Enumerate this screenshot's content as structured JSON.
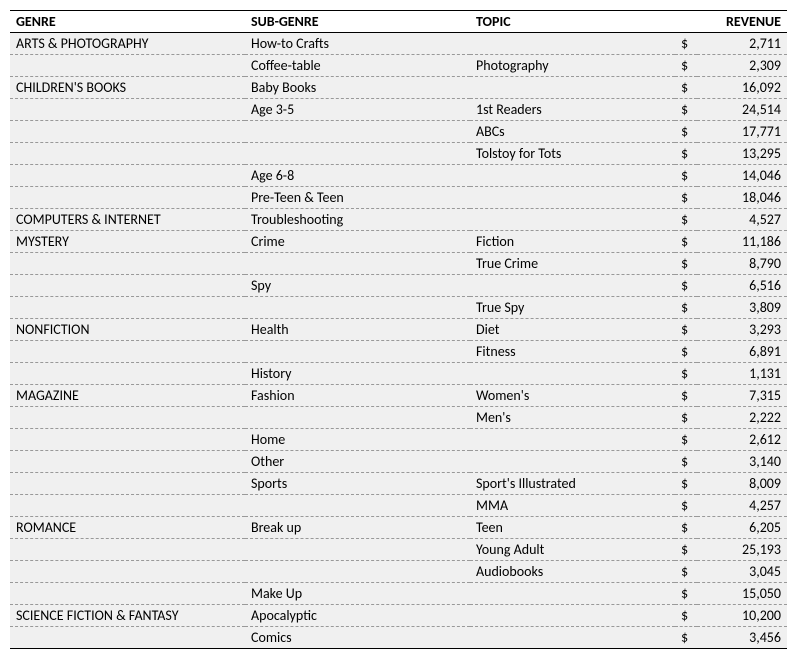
{
  "headers": {
    "genre": "GENRE",
    "subgenre": "SUB-GENRE",
    "topic": "TOPIC",
    "revenue": "REVENUE"
  },
  "currency": "$",
  "rows": [
    {
      "genre": "ARTS & PHOTOGRAPHY",
      "subgenre": "How-to Crafts",
      "topic": "",
      "revenue": "2,711"
    },
    {
      "genre": "",
      "subgenre": "Coffee-table",
      "topic": "Photography",
      "revenue": "2,309"
    },
    {
      "genre": "CHILDREN'S BOOKS",
      "subgenre": "Baby Books",
      "topic": "",
      "revenue": "16,092"
    },
    {
      "genre": "",
      "subgenre": "Age 3-5",
      "topic": "1st Readers",
      "revenue": "24,514"
    },
    {
      "genre": "",
      "subgenre": "",
      "topic": "ABCs",
      "revenue": "17,771"
    },
    {
      "genre": "",
      "subgenre": "",
      "topic": "Tolstoy for Tots",
      "revenue": "13,295"
    },
    {
      "genre": "",
      "subgenre": "Age 6-8",
      "topic": "",
      "revenue": "14,046"
    },
    {
      "genre": "",
      "subgenre": "Pre-Teen & Teen",
      "topic": "",
      "revenue": "18,046"
    },
    {
      "genre": "COMPUTERS & INTERNET",
      "subgenre": "Troubleshooting",
      "topic": "",
      "revenue": "4,527"
    },
    {
      "genre": "MYSTERY",
      "subgenre": "Crime",
      "topic": "Fiction",
      "revenue": "11,186"
    },
    {
      "genre": "",
      "subgenre": "",
      "topic": "True Crime",
      "revenue": "8,790"
    },
    {
      "genre": "",
      "subgenre": "Spy",
      "topic": "",
      "revenue": "6,516"
    },
    {
      "genre": "",
      "subgenre": "",
      "topic": "True Spy",
      "revenue": "3,809"
    },
    {
      "genre": "NONFICTION",
      "subgenre": "Health",
      "topic": "Diet",
      "revenue": "3,293"
    },
    {
      "genre": "",
      "subgenre": "",
      "topic": "Fitness",
      "revenue": "6,891"
    },
    {
      "genre": "",
      "subgenre": "History",
      "topic": "",
      "revenue": "1,131"
    },
    {
      "genre": "MAGAZINE",
      "subgenre": "Fashion",
      "topic": "Women's",
      "revenue": "7,315"
    },
    {
      "genre": "",
      "subgenre": "",
      "topic": "Men's",
      "revenue": "2,222"
    },
    {
      "genre": "",
      "subgenre": "Home",
      "topic": "",
      "revenue": "2,612"
    },
    {
      "genre": "",
      "subgenre": "Other",
      "topic": "",
      "revenue": "3,140"
    },
    {
      "genre": "",
      "subgenre": "Sports",
      "topic": "Sport's Illustrated",
      "revenue": "8,009"
    },
    {
      "genre": "",
      "subgenre": "",
      "topic": "MMA",
      "revenue": "4,257"
    },
    {
      "genre": "ROMANCE",
      "subgenre": "Break up",
      "topic": "Teen",
      "revenue": "6,205"
    },
    {
      "genre": "",
      "subgenre": "",
      "topic": "Young Adult",
      "revenue": "25,193"
    },
    {
      "genre": "",
      "subgenre": "",
      "topic": "Audiobooks",
      "revenue": "3,045"
    },
    {
      "genre": "",
      "subgenre": "Make Up",
      "topic": "",
      "revenue": "15,050"
    },
    {
      "genre": "SCIENCE FICTION & FANTASY",
      "subgenre": "Apocalyptic",
      "topic": "",
      "revenue": "10,200"
    },
    {
      "genre": "",
      "subgenre": "Comics",
      "topic": "",
      "revenue": "3,456"
    }
  ]
}
